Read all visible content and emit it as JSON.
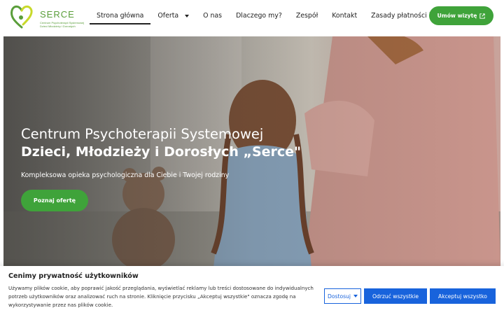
{
  "header": {
    "logo": {
      "title": "SERCE",
      "subtitle": "Centrum Psychoterapii Systemowej Dzieci Młodzieży i Dorosłych"
    },
    "nav": [
      {
        "label": "Strona główna",
        "active": true
      },
      {
        "label": "Oferta",
        "dropdown": true
      },
      {
        "label": "O nas"
      },
      {
        "label": "Dlaczego my?"
      },
      {
        "label": "Zespół"
      },
      {
        "label": "Kontakt"
      },
      {
        "label": "Zasady płatności i cennik"
      }
    ],
    "cta_label": "Umów wizytę",
    "cta_icon": "external-link-icon"
  },
  "hero": {
    "title_line1": "Centrum Psychoterapii Systemowej",
    "title_line2": "Dzieci, Młodzieży i Dorosłych „Serce\"",
    "subtitle": "Kompleksowa opieka psychologiczna dla Ciebie i Twojej rodziny",
    "button_label": "Poznaj ofertę"
  },
  "cookie_banner": {
    "title": "Cenimy prywatność użytkowników",
    "text": "Używamy plików cookie, aby poprawić jakość przeglądania, wyświetlać reklamy lub treści dostosowane do indywidualnych potrzeb użytkowników oraz analizować ruch na stronie. Kliknięcie przycisku „Akceptuj wszystkie\" oznacza zgodę na wykorzystywanie przez nas plików cookie.",
    "customize_label": "Dostosuj",
    "reject_label": "Odrzuć wszystkie",
    "accept_label": "Akceptuj wszystko"
  },
  "colors": {
    "brand_green": "#3fa33a",
    "cookie_blue": "#1863dc"
  }
}
